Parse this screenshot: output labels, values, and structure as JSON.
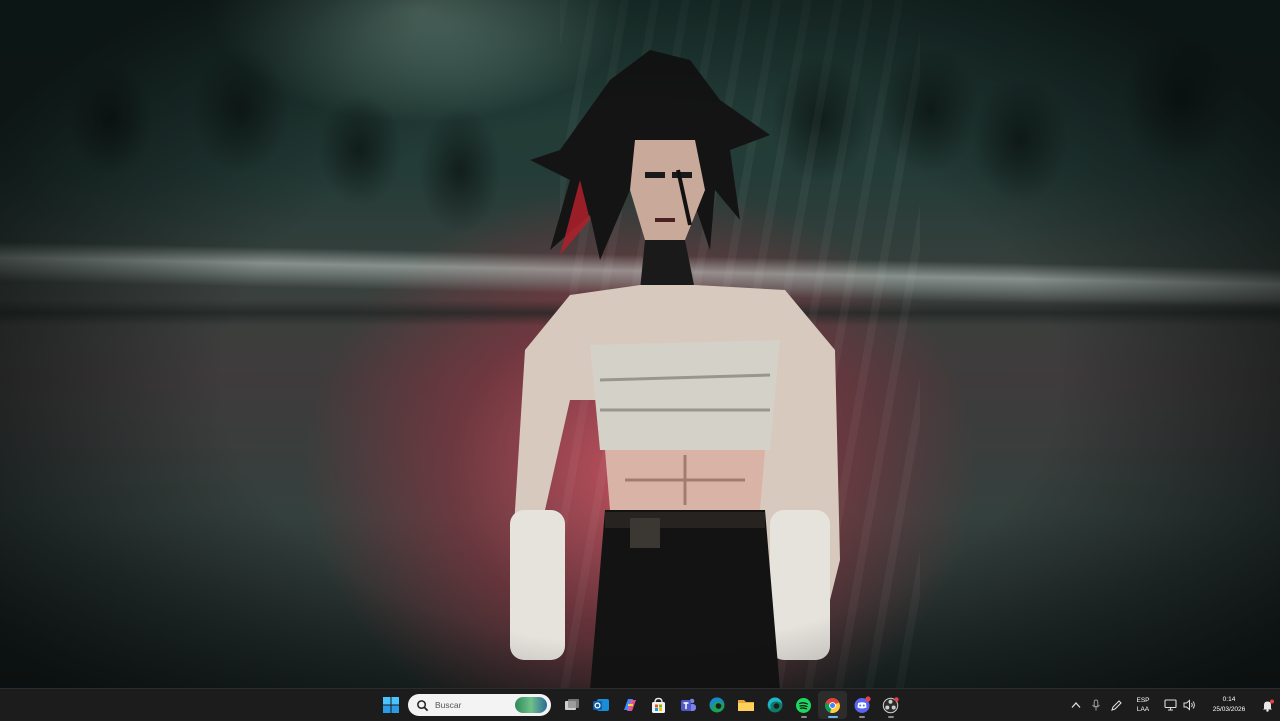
{
  "desktop": {
    "wallpaper_icon": "anime-fighter-wallpaper",
    "colors": {
      "glow": "#d65464",
      "shadow": "#1f3a34"
    }
  },
  "taskbar": {
    "background": "#1c1c1c",
    "start_icon": "windows-start-icon",
    "search": {
      "placeholder": "Buscar",
      "icon": "search-icon"
    },
    "pinned_apps": [
      {
        "name": "task-view",
        "icon": "task-view-icon"
      },
      {
        "name": "outlook",
        "icon": "outlook-icon"
      },
      {
        "name": "copilot",
        "icon": "copilot-icon"
      },
      {
        "name": "microsoft-store",
        "icon": "store-icon"
      },
      {
        "name": "teams",
        "icon": "teams-icon"
      },
      {
        "name": "edge",
        "icon": "edge-icon"
      },
      {
        "name": "file-explorer",
        "icon": "folder-icon"
      },
      {
        "name": "edge-dev",
        "icon": "edge-dev-icon"
      },
      {
        "name": "spotify",
        "icon": "spotify-icon"
      },
      {
        "name": "chrome",
        "icon": "chrome-icon"
      },
      {
        "name": "discord",
        "icon": "discord-icon"
      },
      {
        "name": "obs",
        "icon": "obs-icon"
      }
    ],
    "tray": {
      "language": {
        "line1": "ESP",
        "line2": "LAA"
      },
      "time": "0:14",
      "date": "25/03/2026"
    }
  }
}
